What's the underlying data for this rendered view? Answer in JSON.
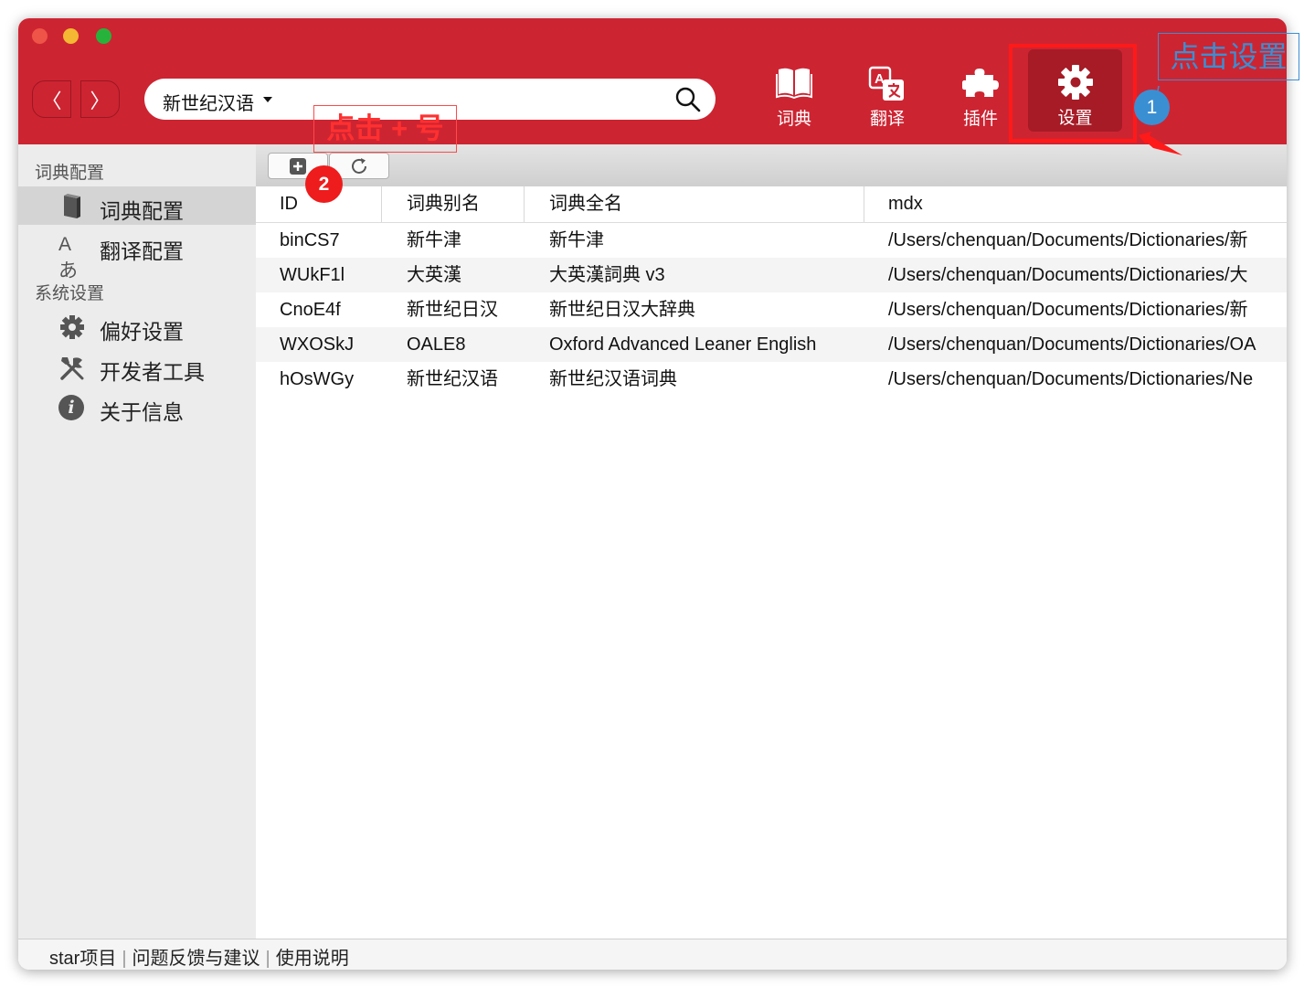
{
  "titlebar": {
    "nav": {
      "back_glyph": "〈",
      "forward_glyph": "〉"
    },
    "search": {
      "dictionary": "新世纪汉语"
    },
    "tools": [
      {
        "label": "词典",
        "icon": "book-icon"
      },
      {
        "label": "翻译",
        "icon": "translate-icon"
      },
      {
        "label": "插件",
        "icon": "puzzle-icon"
      },
      {
        "label": "设置",
        "icon": "gear-icon",
        "active": true
      }
    ],
    "colors": {
      "bar": "#cd2432",
      "active_tab": "#a61b26"
    }
  },
  "sidebar": {
    "section1": "词典配置",
    "items1": [
      {
        "label": "词典配置",
        "icon": "book-icon",
        "selected": true
      },
      {
        "label": "翻译配置",
        "icon": "translate-icon",
        "icon_text": "Aあ"
      }
    ],
    "section2": "系统设置",
    "items2": [
      {
        "label": "偏好设置",
        "icon": "gear-icon"
      },
      {
        "label": "开发者工具",
        "icon": "tools-icon"
      },
      {
        "label": "关于信息",
        "icon": "info-icon",
        "icon_text": "i"
      }
    ]
  },
  "table": {
    "columns": [
      "ID",
      "词典别名",
      "词典全名",
      "mdx"
    ],
    "rows": [
      [
        "binCS7",
        "新牛津",
        "新牛津",
        "/Users/chenquan/Documents/Dictionaries/新"
      ],
      [
        "WUkF1l",
        "大英漢",
        "大英漢詞典 v3",
        "/Users/chenquan/Documents/Dictionaries/大"
      ],
      [
        "CnoE4f",
        "新世纪日汉",
        "新世纪日汉大辞典",
        "/Users/chenquan/Documents/Dictionaries/新"
      ],
      [
        "WXOSkJ",
        "OALE8",
        "Oxford Advanced Leaner English",
        "/Users/chenquan/Documents/Dictionaries/OA"
      ],
      [
        "hOsWGy",
        "新世纪汉语",
        "新世纪汉语词典",
        "/Users/chenquan/Documents/Dictionaries/Ne"
      ]
    ]
  },
  "footer": {
    "links": [
      "star项目",
      "问题反馈与建议",
      "使用说明"
    ],
    "separator": "|"
  },
  "annotations": {
    "click_settings": "点击设置",
    "click_plus": "点击 + 号",
    "badge1": "1",
    "badge2": "2",
    "colors": {
      "red": "#ff1a1a",
      "blue": "#3a8fd3"
    }
  }
}
